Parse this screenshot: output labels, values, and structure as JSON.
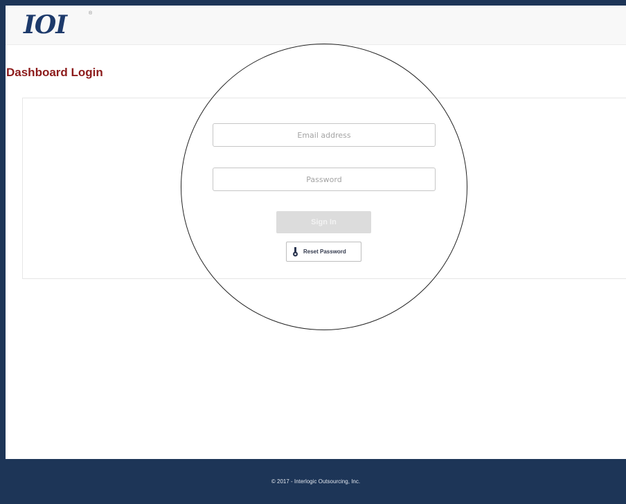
{
  "header": {
    "logo_text": "IOI",
    "logo_mark": "®"
  },
  "page": {
    "title": "Dashboard Login"
  },
  "login": {
    "email_placeholder": "Email address",
    "password_placeholder": "Password",
    "signin_label": "Sign In",
    "reset_label": "Reset Password",
    "reset_icon": "key-icon"
  },
  "footer": {
    "copyright": "© 2017 - Interlogic Outsourcing, Inc."
  },
  "colors": {
    "frame": "#1d3557",
    "title": "#8c1b1b",
    "logo": "#1d3a6b",
    "signin_bg": "#dcdcdc"
  }
}
